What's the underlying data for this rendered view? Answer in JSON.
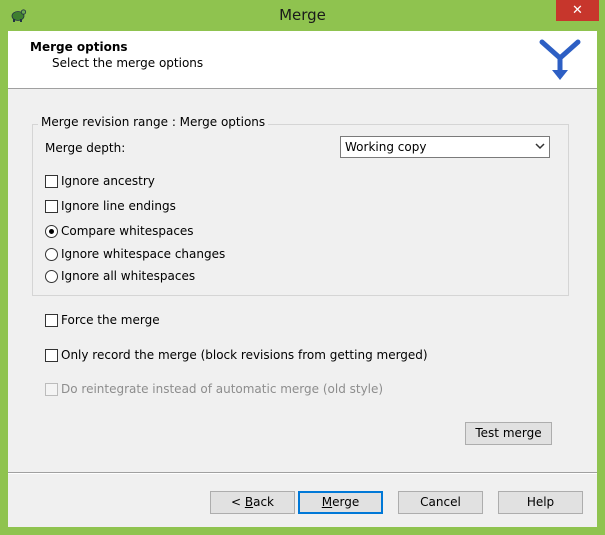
{
  "window": {
    "title": "Merge",
    "close_glyph": "✕"
  },
  "header": {
    "title": "Merge options",
    "subtitle": "Select the merge options"
  },
  "group": {
    "legend": "Merge revision range : Merge options",
    "merge_depth_label": "Merge depth:",
    "merge_depth_value": "Working copy",
    "ignore_ancestry": {
      "label": "Ignore ancestry",
      "checked": false
    },
    "ignore_line_endings": {
      "label": "Ignore line endings",
      "checked": false
    },
    "whitespace_options": [
      {
        "label": "Compare whitespaces",
        "selected": true
      },
      {
        "label": "Ignore whitespace changes",
        "selected": false
      },
      {
        "label": "Ignore all whitespaces",
        "selected": false
      }
    ]
  },
  "options": {
    "force_merge": {
      "label": "Force the merge",
      "checked": false
    },
    "record_only": {
      "label": "Only record the merge (block revisions from getting merged)",
      "checked": false
    },
    "reintegrate": {
      "label": "Do reintegrate instead of automatic merge (old style)",
      "checked": false,
      "enabled": false
    }
  },
  "buttons": {
    "test_merge": "Test merge",
    "back_prefix": "< ",
    "back_mnemonic": "B",
    "back_rest": "ack",
    "merge_mnemonic": "M",
    "merge_rest": "erge",
    "cancel": "Cancel",
    "help": "Help"
  },
  "colors": {
    "frame": "#8fc34f",
    "close": "#c7362c",
    "default_button_border": "#0078d7"
  }
}
